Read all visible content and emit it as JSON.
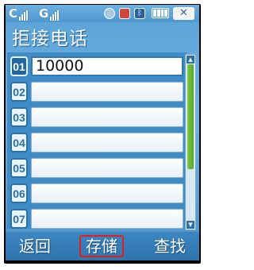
{
  "status_bar": {
    "signal_1_label": "C",
    "signal_2_label": "G",
    "icons": [
      "alarm-icon",
      "message-icon",
      "bluetooth-icon",
      "battery-icon"
    ],
    "close_label": "✕"
  },
  "title": "拒接电话",
  "list": {
    "items": [
      {
        "number": "01",
        "value": "10000",
        "selected": true
      },
      {
        "number": "02",
        "value": ""
      },
      {
        "number": "03",
        "value": ""
      },
      {
        "number": "04",
        "value": ""
      },
      {
        "number": "05",
        "value": ""
      },
      {
        "number": "06",
        "value": ""
      },
      {
        "number": "07",
        "value": ""
      }
    ]
  },
  "softkeys": {
    "left": "返回",
    "center": "存储",
    "right": "查找"
  },
  "colors": {
    "background": "#5aa2d8",
    "highlight_border": "#e21d1d",
    "scroll_thumb": "#7cc943"
  }
}
